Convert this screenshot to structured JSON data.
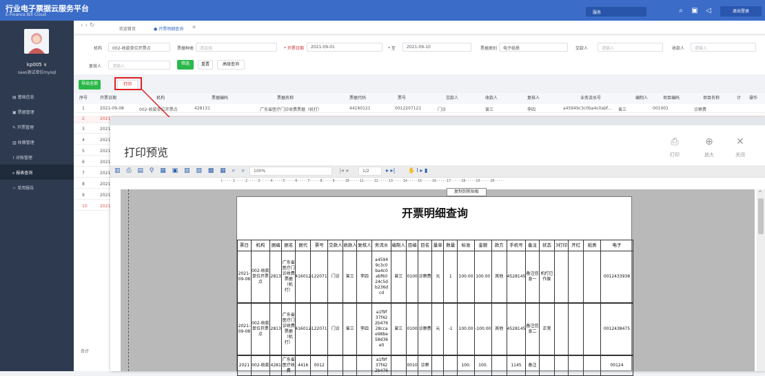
{
  "app": {
    "title": "行业电子票据云服务平台",
    "subtitle": "E-Finance Bill Cloud",
    "search": "服务",
    "logout": "退出登录"
  },
  "user": {
    "name": "kp005 ∨",
    "org": "saas测试单位mysql"
  },
  "sidebar": {
    "items": [
      {
        "label": "基础信息"
      },
      {
        "label": "票据管理"
      },
      {
        "label": "开票管理"
      },
      {
        "label": "收缴管理"
      },
      {
        "label": "对账管理"
      },
      {
        "label": "报表查询"
      },
      {
        "label": "单用报告"
      }
    ]
  },
  "tabs": [
    {
      "label": "欢迎首页"
    },
    {
      "label": "● 开票明细查询"
    }
  ],
  "filters": {
    "org_label": "机构",
    "org_value": "002-收款单位开票点",
    "type_label": "票据种类",
    "type_placeholder": "请选择",
    "date_label": "* 开票日期",
    "date_from": "2021-09-01",
    "date_to_label": "* 至",
    "date_to": "2021-09-10",
    "status_label": "票据类别",
    "status_value": "电子纸质",
    "payer_label": "交款人",
    "payer_placeholder": "请输入",
    "payee_label": "收款人",
    "payee_placeholder": "请输入",
    "reviewer_label": "复核人",
    "reviewer_placeholder": "请输入",
    "filter_btn": "筛选",
    "reset_btn": "重置",
    "advanced_btn": "高级查询",
    "export_btn": "导出全部",
    "print_btn": "打印"
  },
  "table": {
    "headers": [
      "序号",
      "开票日期",
      "机构",
      "票据编码",
      "票据名称",
      "票据代码",
      "票号",
      "交款人",
      "收款人",
      "复核人",
      "业务流水号",
      "编制人",
      "项目编码",
      "项目名称",
      "计",
      "操作"
    ],
    "row1": [
      "1",
      "2021-09-08",
      "002-收款单位开票点",
      "428131",
      "广东省医疗门诊收费票据（机打）",
      "44160121",
      "0012207121",
      "门诊",
      "曾三",
      "李四",
      "a45949c3c0ba4c0abf...",
      "曾三",
      "001001",
      "诊察费"
    ],
    "row_nums": [
      "2",
      "3",
      "4",
      "5",
      "6",
      "7",
      "8",
      "9",
      "10"
    ],
    "row_date": "2021-",
    "total": "合计"
  },
  "preview": {
    "title": "打印预览",
    "print": "打印",
    "zoom_in": "放大",
    "close": "关闭",
    "zoom": "100%",
    "page": "1/2",
    "tooltip": "复制到剪贴板",
    "ruler": ")·····1·····2·····3·····4·····5·····6·····7·····8·····9·····10·····11·····12·····13·····14·····15·····16·····17·····18·····19·····20·····"
  },
  "report": {
    "title": "开票明细查询",
    "headers": [
      "票日",
      "机构",
      "据编",
      "据名",
      "据代",
      "票号",
      "交款人",
      "收款人",
      "复核人",
      "务流水",
      "编制人",
      "目编",
      "目名",
      "量单",
      "数量",
      "标准",
      "金额",
      "款方",
      "手机号",
      "备注",
      "状态",
      "3打印",
      "开红",
      "纸质",
      "电子"
    ],
    "rows": [
      {
        "date": "2021-09-08",
        "org": "002-收款单位开票点",
        "code": "428131",
        "name": "广东省医疗门诊收费票据（机打）",
        "dm": "44160121",
        "no": "0012207121",
        "payer": "门诊",
        "payee": "曾三",
        "rev": "李四",
        "flow": "a4594 9c3c0 ba4c0 abf60 24c5d b236d cd",
        "maker": "曾三",
        "icode": "001001",
        "iname": "诊察费",
        "unit": "元",
        "qty": "1",
        "std": "100.00",
        "amt": "100.00",
        "pay": "其他",
        "tel": "11452814524",
        "remark": "备注信息一",
        "status": "机打已作废",
        "elec": "0012433938"
      },
      {
        "date": "2021-09-08",
        "org": "002-收款单位开票点",
        "code": "428131",
        "name": "广东省医疗门诊收费票据（机打）",
        "dm": "44160121",
        "no": "0012207120",
        "payer": "门诊",
        "payee": "曾三",
        "rev": "李四",
        "flow": "a1f9f 37f42 2b476 28cca e98be 58d36 e0",
        "maker": "曾三",
        "icode": "001001",
        "iname": "诊察费",
        "unit": "元",
        "qty": "-1",
        "std": "100.00",
        "amt": "-100.00",
        "pay": "其他",
        "tel": "11452814524",
        "remark": "备注信息二",
        "status": "正常",
        "elec": "0012438475"
      },
      {
        "date": "2021",
        "org": "002-收款",
        "code": "4281",
        "name": "广东省医疗收费",
        "dm": "4416",
        "no": "0012",
        "payer": "",
        "payee": "",
        "rev": "",
        "flow": "a1f9f 37f42 2b476",
        "maker": "",
        "icode": "0010",
        "iname": "诊察",
        "unit": "",
        "qty": "",
        "std": "100.",
        "amt": "100.",
        "pay": "",
        "tel": "1145",
        "remark": "备注",
        "status": "",
        "elec": "00124"
      }
    ]
  }
}
